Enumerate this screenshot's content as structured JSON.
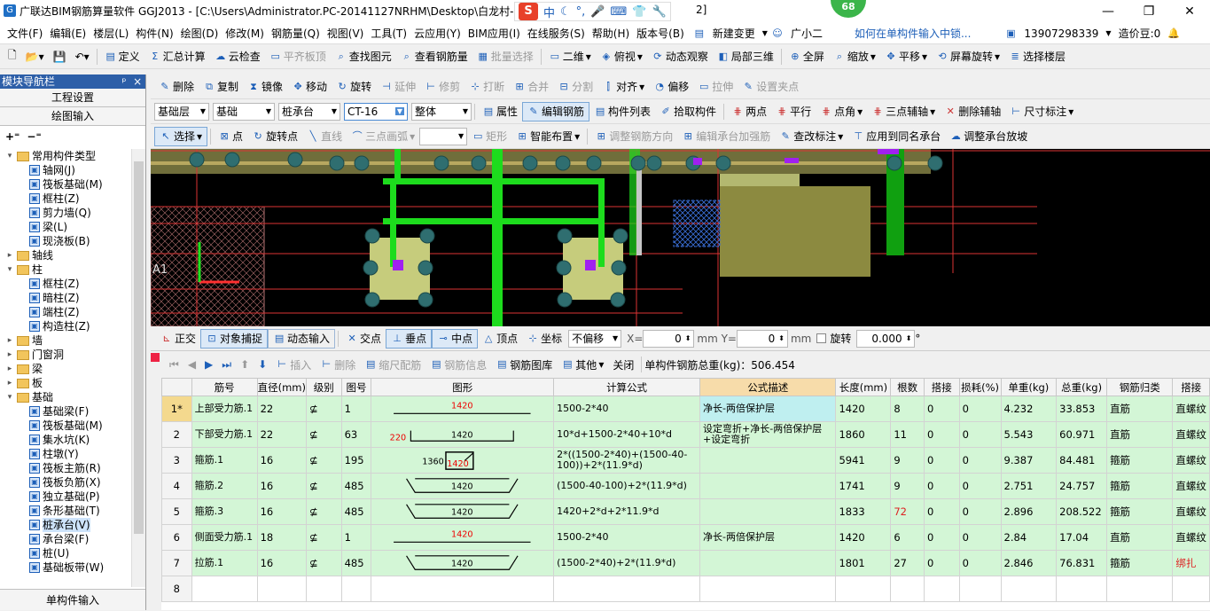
{
  "titlebar": {
    "title": "广联达BIM钢筋算量软件 GGJ2013 - [C:\\Users\\Administrator.PC-20141127NRHM\\Desktop\\白龙村-",
    "title_tail": "2]",
    "ime_label": "中",
    "badge": "68"
  },
  "menu": {
    "items": [
      "文件(F)",
      "编辑(E)",
      "楼层(L)",
      "构件(N)",
      "绘图(D)",
      "修改(M)",
      "钢筋量(Q)",
      "视图(V)",
      "工具(T)",
      "云应用(Y)",
      "BIM应用(I)",
      "在线服务(S)",
      "帮助(H)",
      "版本号(B)"
    ],
    "new_change": "新建变更",
    "assistant": "广小二",
    "question": "如何在单构件输入中锁...",
    "phone": "13907298339",
    "cost_bean": "造价豆:0"
  },
  "toolbar1": {
    "items": [
      "定义",
      "汇总计算",
      "云检查",
      "平齐板顶",
      "查找图元",
      "查看钢筋量",
      "批量选择",
      "二维",
      "俯视",
      "动态观察",
      "局部三维",
      "全屏",
      "缩放",
      "平移",
      "屏幕旋转",
      "选择楼层"
    ]
  },
  "toolbar2": {
    "items": [
      "删除",
      "复制",
      "镜像",
      "移动",
      "旋转",
      "延伸",
      "修剪",
      "打断",
      "合并",
      "分割",
      "对齐",
      "偏移",
      "拉伸",
      "设置夹点"
    ]
  },
  "toolbar3": {
    "floor": "基础层",
    "category": "基础",
    "type": "桩承台",
    "element": "CT-16",
    "whole": "整体",
    "items": [
      "属性",
      "编辑钢筋",
      "构件列表",
      "拾取构件",
      "两点",
      "平行",
      "点角",
      "三点辅轴",
      "删除辅轴",
      "尺寸标注"
    ]
  },
  "toolbar4": {
    "items": [
      "选择",
      "点",
      "旋转点",
      "直线",
      "三点画弧",
      "矩形",
      "智能布置",
      "调整钢筋方向",
      "编辑承台加强筋",
      "查改标注",
      "应用到同名承台",
      "调整承台放坡"
    ]
  },
  "leftpanel": {
    "header": "模块导航栏",
    "pin": "ᵖ",
    "close": "×",
    "btn1": "工程设置",
    "btn2": "绘图输入",
    "bottom": "单构件输入",
    "tree": [
      {
        "label": "常用构件类型",
        "level": 0,
        "type": "folder",
        "exp": "−"
      },
      {
        "label": "轴网(J)",
        "level": 1,
        "type": "item"
      },
      {
        "label": "筏板基础(M)",
        "level": 1,
        "type": "item"
      },
      {
        "label": "框柱(Z)",
        "level": 1,
        "type": "item"
      },
      {
        "label": "剪力墙(Q)",
        "level": 1,
        "type": "item"
      },
      {
        "label": "梁(L)",
        "level": 1,
        "type": "item"
      },
      {
        "label": "现浇板(B)",
        "level": 1,
        "type": "item"
      },
      {
        "label": "轴线",
        "level": 0,
        "type": "folder",
        "exp": "+"
      },
      {
        "label": "柱",
        "level": 0,
        "type": "folder",
        "exp": "−"
      },
      {
        "label": "框柱(Z)",
        "level": 1,
        "type": "item"
      },
      {
        "label": "暗柱(Z)",
        "level": 1,
        "type": "item"
      },
      {
        "label": "端柱(Z)",
        "level": 1,
        "type": "item"
      },
      {
        "label": "构造柱(Z)",
        "level": 1,
        "type": "item"
      },
      {
        "label": "墙",
        "level": 0,
        "type": "folder",
        "exp": "+"
      },
      {
        "label": "门窗洞",
        "level": 0,
        "type": "folder",
        "exp": "+"
      },
      {
        "label": "梁",
        "level": 0,
        "type": "folder",
        "exp": "+"
      },
      {
        "label": "板",
        "level": 0,
        "type": "folder",
        "exp": "+"
      },
      {
        "label": "基础",
        "level": 0,
        "type": "folder",
        "exp": "−"
      },
      {
        "label": "基础梁(F)",
        "level": 1,
        "type": "item"
      },
      {
        "label": "筏板基础(M)",
        "level": 1,
        "type": "item"
      },
      {
        "label": "集水坑(K)",
        "level": 1,
        "type": "item"
      },
      {
        "label": "柱墩(Y)",
        "level": 1,
        "type": "item"
      },
      {
        "label": "筏板主筋(R)",
        "level": 1,
        "type": "item"
      },
      {
        "label": "筏板负筋(X)",
        "level": 1,
        "type": "item"
      },
      {
        "label": "独立基础(P)",
        "level": 1,
        "type": "item"
      },
      {
        "label": "条形基础(T)",
        "level": 1,
        "type": "item"
      },
      {
        "label": "桩承台(V)",
        "level": 1,
        "type": "item",
        "selected": true
      },
      {
        "label": "承台梁(F)",
        "level": 1,
        "type": "item"
      },
      {
        "label": "桩(U)",
        "level": 1,
        "type": "item"
      },
      {
        "label": "基础板带(W)",
        "level": 1,
        "type": "item"
      }
    ]
  },
  "canvas": {
    "axis_label": "A1"
  },
  "snapbar": {
    "items": [
      "正交",
      "对象捕捉",
      "动态输入",
      "交点",
      "垂点",
      "中点",
      "顶点",
      "坐标"
    ],
    "offset": "不偏移",
    "x_label": "X=",
    "x_value": "0",
    "y_label": "mm Y=",
    "y_value": "0",
    "unit": "mm",
    "rotate": "旋转",
    "rotate_value": "0.000",
    "deg": "°"
  },
  "gridtoolbar": {
    "items": [
      "插入",
      "删除",
      "缩尺配筋",
      "钢筋信息",
      "钢筋图库",
      "其他",
      "关闭"
    ],
    "total": "单构件钢筋总重(kg)：506.454"
  },
  "grid": {
    "headers": [
      "",
      "筋号",
      "直径(mm)",
      "级别",
      "图号",
      "图形",
      "计算公式",
      "公式描述",
      "长度(mm)",
      "根数",
      "搭接",
      "损耗(%)",
      "单重(kg)",
      "总重(kg)",
      "钢筋归类",
      "搭接"
    ],
    "rows": [
      {
        "rn": "1*",
        "name": "上部受力筋.1",
        "dia": "22",
        "grade": "⊈",
        "fig": "1",
        "shape": "line",
        "shape_vals": [
          "1420"
        ],
        "formula": "1500-2*40",
        "desc": "净长-两倍保护层",
        "len": "1420",
        "count": "8",
        "lap": "0",
        "loss": "0",
        "unit_w": "4.232",
        "total_w": "33.853",
        "cat": "直筋",
        "lap2": "直螺纹"
      },
      {
        "rn": "2",
        "name": "下部受力筋.1",
        "dia": "22",
        "grade": "⊈",
        "fig": "63",
        "shape": "u",
        "shape_vals": [
          "220",
          "1420"
        ],
        "formula": "10*d+1500-2*40+10*d",
        "desc": "设定弯折+净长-两倍保护层+设定弯折",
        "len": "1860",
        "count": "11",
        "lap": "0",
        "loss": "0",
        "unit_w": "5.543",
        "total_w": "60.971",
        "cat": "直筋",
        "lap2": "直螺纹"
      },
      {
        "rn": "3",
        "name": "箍筋.1",
        "dia": "16",
        "grade": "⊈",
        "fig": "195",
        "shape": "rect",
        "shape_vals": [
          "1360",
          "1420"
        ],
        "formula": "2*((1500-2*40)+(1500-40-100))+2*(11.9*d)",
        "desc": "",
        "len": "5941",
        "count": "9",
        "lap": "0",
        "loss": "0",
        "unit_w": "9.387",
        "total_w": "84.481",
        "cat": "箍筋",
        "lap2": "直螺纹"
      },
      {
        "rn": "4",
        "name": "箍筋.2",
        "dia": "16",
        "grade": "⊈",
        "fig": "485",
        "shape": "hook",
        "shape_vals": [
          "1420"
        ],
        "formula": "(1500-40-100)+2*(11.9*d)",
        "desc": "",
        "len": "1741",
        "count": "9",
        "lap": "0",
        "loss": "0",
        "unit_w": "2.751",
        "total_w": "24.757",
        "cat": "箍筋",
        "lap2": "直螺纹"
      },
      {
        "rn": "5",
        "name": "箍筋.3",
        "dia": "16",
        "grade": "⊈",
        "fig": "485",
        "shape": "hook",
        "shape_vals": [
          "1420"
        ],
        "formula": "1420+2*d+2*11.9*d",
        "desc": "",
        "len": "1833",
        "count": "72",
        "lap": "0",
        "loss": "0",
        "unit_w": "2.896",
        "total_w": "208.522",
        "cat": "箍筋",
        "lap2": "直螺纹",
        "count_red": true
      },
      {
        "rn": "6",
        "name": "侧面受力筋.1",
        "dia": "18",
        "grade": "⊈",
        "fig": "1",
        "shape": "line",
        "shape_vals": [
          "1420"
        ],
        "formula": "1500-2*40",
        "desc": "净长-两倍保护层",
        "len": "1420",
        "count": "6",
        "lap": "0",
        "loss": "0",
        "unit_w": "2.84",
        "total_w": "17.04",
        "cat": "直筋",
        "lap2": "直螺纹"
      },
      {
        "rn": "7",
        "name": "拉筋.1",
        "dia": "16",
        "grade": "⊈",
        "fig": "485",
        "shape": "hook",
        "shape_vals": [
          "1420"
        ],
        "formula": "(1500-2*40)+2*(11.9*d)",
        "desc": "",
        "len": "1801",
        "count": "27",
        "lap": "0",
        "loss": "0",
        "unit_w": "2.846",
        "total_w": "76.831",
        "cat": "箍筋",
        "lap2": "绑扎",
        "lap2_red": true
      },
      {
        "rn": "8",
        "name": "",
        "dia": "",
        "grade": "",
        "fig": "",
        "shape": "",
        "shape_vals": [],
        "formula": "",
        "desc": "",
        "len": "",
        "count": "",
        "lap": "",
        "loss": "",
        "unit_w": "",
        "total_w": "",
        "cat": "",
        "lap2": ""
      }
    ]
  }
}
